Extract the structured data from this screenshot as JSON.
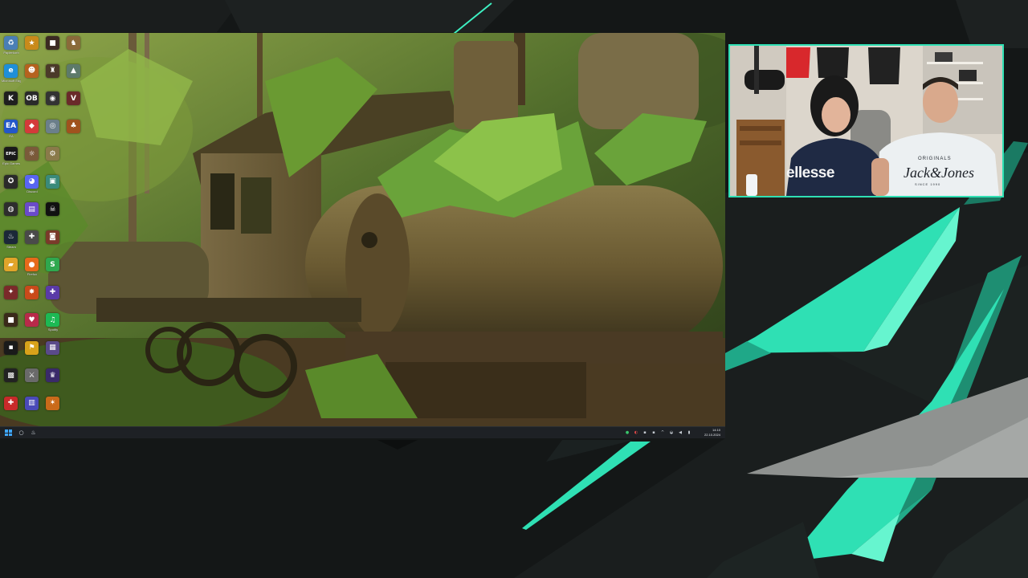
{
  "overlay": {
    "background_color": "#141717",
    "accent_color": "#2fe0b4",
    "accent_light": "#66f5cf",
    "panel_gray": "#8f9290"
  },
  "desktop": {
    "wallpaper": "abandoned steam locomotive overgrown with ferns in jungle",
    "icons": [
      {
        "name": "recycle-bin-icon",
        "glyph": "♻",
        "caption": "Papierkorb",
        "color": "#4a7fb5"
      },
      {
        "name": "app-icon",
        "glyph": "★",
        "caption": "",
        "color": "#c98a1a"
      },
      {
        "name": "game-icon",
        "glyph": "■",
        "caption": "",
        "color": "#3b2a22"
      },
      {
        "name": "game-icon",
        "glyph": "♞",
        "caption": "",
        "color": "#8a6a3a"
      },
      {
        "name": "edge-icon",
        "glyph": "e",
        "caption": "Microsoft Edge",
        "color": "#1f8fd8"
      },
      {
        "name": "game-icon",
        "glyph": "☻",
        "caption": "",
        "color": "#b5621e"
      },
      {
        "name": "game-icon",
        "glyph": "♜",
        "caption": "",
        "color": "#4b3a29"
      },
      {
        "name": "game-icon",
        "glyph": "▲",
        "caption": "",
        "color": "#5d7a6a"
      },
      {
        "name": "game-icon",
        "glyph": "K",
        "caption": "",
        "color": "#1f1f1f"
      },
      {
        "name": "obs-icon",
        "glyph": "OB",
        "caption": "",
        "color": "#2a2a2a"
      },
      {
        "name": "obs-icon",
        "glyph": "◉",
        "caption": "",
        "color": "#333333"
      },
      {
        "name": "game-icon",
        "glyph": "V",
        "caption": "",
        "color": "#6a2a2a"
      },
      {
        "name": "ea-app-icon",
        "glyph": "EA",
        "caption": "EA",
        "color": "#2357c9"
      },
      {
        "name": "app-icon",
        "glyph": "◆",
        "caption": "",
        "color": "#d43a3a"
      },
      {
        "name": "app-icon",
        "glyph": "◎",
        "caption": "",
        "color": "#6b7f8a"
      },
      {
        "name": "game-icon",
        "glyph": "♣",
        "caption": "",
        "color": "#a0521e"
      },
      {
        "name": "epic-games-icon",
        "glyph": "EPIC",
        "caption": "Epic Games",
        "color": "#1a1a1a"
      },
      {
        "name": "app-icon",
        "glyph": "☼",
        "caption": "",
        "color": "#7a5a3a"
      },
      {
        "name": "game-icon",
        "glyph": "⚙",
        "caption": "",
        "color": "#8a7a4a"
      },
      {
        "name": "blank-icon",
        "glyph": "",
        "caption": "",
        "color": "transparent"
      },
      {
        "name": "app-icon",
        "glyph": "✪",
        "caption": "",
        "color": "#2a2a2a"
      },
      {
        "name": "discord-icon",
        "glyph": "◕",
        "caption": "Discord",
        "color": "#5865f2"
      },
      {
        "name": "app-icon",
        "glyph": "▣",
        "caption": "",
        "color": "#3a8a7a"
      },
      {
        "name": "blank-icon",
        "glyph": "",
        "caption": "",
        "color": "transparent"
      },
      {
        "name": "app-icon",
        "glyph": "◍",
        "caption": "",
        "color": "#2d2d2d"
      },
      {
        "name": "app-icon",
        "glyph": "▤",
        "caption": "",
        "color": "#6a4ac9"
      },
      {
        "name": "app-icon",
        "glyph": "☠",
        "caption": "",
        "color": "#111111"
      },
      {
        "name": "blank-icon",
        "glyph": "",
        "caption": "",
        "color": "transparent"
      },
      {
        "name": "steam-icon",
        "glyph": "♨",
        "caption": "Steam",
        "color": "#1b2838"
      },
      {
        "name": "controller-icon",
        "glyph": "✚",
        "caption": "",
        "color": "#4a4a4a"
      },
      {
        "name": "game-icon",
        "glyph": "◙",
        "caption": "",
        "color": "#7a3a2a"
      },
      {
        "name": "blank-icon",
        "glyph": "",
        "caption": "",
        "color": "transparent"
      },
      {
        "name": "folder-icon",
        "glyph": "▰",
        "caption": "",
        "color": "#e0a42a"
      },
      {
        "name": "firefox-icon",
        "glyph": "●",
        "caption": "Firefox",
        "color": "#e66a1a"
      },
      {
        "name": "app-icon",
        "glyph": "S",
        "caption": "",
        "color": "#2fa84f"
      },
      {
        "name": "blank-icon",
        "glyph": "",
        "caption": "",
        "color": "transparent"
      },
      {
        "name": "app-icon",
        "glyph": "✦",
        "caption": "",
        "color": "#7a2a2a"
      },
      {
        "name": "game-icon",
        "glyph": "✸",
        "caption": "",
        "color": "#c94a1a"
      },
      {
        "name": "app-icon",
        "glyph": "✚",
        "caption": "",
        "color": "#5a3aa8"
      },
      {
        "name": "blank-icon",
        "glyph": "",
        "caption": "",
        "color": "transparent"
      },
      {
        "name": "app-icon",
        "glyph": "■",
        "caption": "",
        "color": "#3a2a1a"
      },
      {
        "name": "app-icon",
        "glyph": "♥",
        "caption": "",
        "color": "#b82a4a"
      },
      {
        "name": "spotify-icon",
        "glyph": "♫",
        "caption": "Spotify",
        "color": "#1db954"
      },
      {
        "name": "blank-icon",
        "glyph": "",
        "caption": "",
        "color": "transparent"
      },
      {
        "name": "app-icon",
        "glyph": "▪",
        "caption": "",
        "color": "#1a1a1a"
      },
      {
        "name": "app-icon",
        "glyph": "⚑",
        "caption": "",
        "color": "#d8a21a"
      },
      {
        "name": "app-icon",
        "glyph": "▦",
        "caption": "",
        "color": "#5a4a8a"
      },
      {
        "name": "blank-icon",
        "glyph": "",
        "caption": "",
        "color": "transparent"
      },
      {
        "name": "app-icon",
        "glyph": "▩",
        "caption": "",
        "color": "#222222"
      },
      {
        "name": "app-icon",
        "glyph": "⚔",
        "caption": "",
        "color": "#6a6a6a"
      },
      {
        "name": "game-icon",
        "glyph": "♛",
        "caption": "",
        "color": "#3a2a6a"
      },
      {
        "name": "blank-icon",
        "glyph": "",
        "caption": "",
        "color": "transparent"
      },
      {
        "name": "app-icon",
        "glyph": "✚",
        "caption": "",
        "color": "#c82a2a"
      },
      {
        "name": "app-icon",
        "glyph": "▥",
        "caption": "",
        "color": "#4a4ab8"
      },
      {
        "name": "game-icon",
        "glyph": "✶",
        "caption": "",
        "color": "#c96a1a"
      }
    ]
  },
  "taskbar": {
    "pinned": [
      {
        "name": "start-button-icon",
        "glyph": ""
      },
      {
        "name": "search-icon",
        "glyph": "○"
      },
      {
        "name": "steam-taskbar-icon",
        "glyph": "♨"
      }
    ],
    "tray": [
      {
        "name": "tray-app-icon",
        "glyph": "●",
        "color": "#39c66b"
      },
      {
        "name": "tray-app-icon",
        "glyph": "◐",
        "color": "#e04848"
      },
      {
        "name": "tray-app-icon",
        "glyph": "▪",
        "color": "#c7cdd3"
      },
      {
        "name": "tray-app-icon",
        "glyph": "▪",
        "color": "#c7cdd3"
      },
      {
        "name": "tray-chevron-icon",
        "glyph": "^",
        "color": "#c7cdd3"
      },
      {
        "name": "network-icon",
        "glyph": "◒",
        "color": "#c7cdd3"
      },
      {
        "name": "volume-icon",
        "glyph": "◀",
        "color": "#c7cdd3"
      },
      {
        "name": "battery-icon",
        "glyph": "▮",
        "color": "#c7cdd3"
      }
    ],
    "clock_time": "14:10",
    "clock_date": "22.10.2024"
  },
  "webcam": {
    "hoodie_logo": "ellesse",
    "tshirt_top": "ORIGINALS",
    "tshirt_logo": "Jack&Jones",
    "tshirt_sub": "SINCE 1990"
  }
}
